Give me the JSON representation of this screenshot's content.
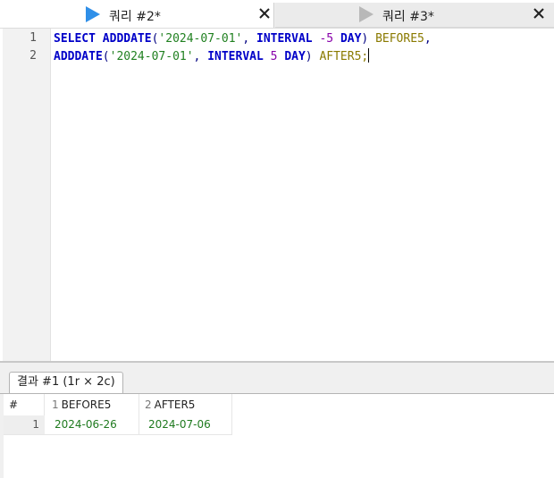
{
  "tabs": [
    {
      "label": "쿼리 #2*",
      "active": true,
      "icon": "play-icon",
      "icon_color": "#2f8fe8"
    },
    {
      "label": "쿼리 #3*",
      "active": false,
      "icon": "play-icon",
      "icon_color": "#b8b8b8"
    }
  ],
  "editor": {
    "line_numbers": [
      "1",
      "2"
    ],
    "lines": [
      [
        {
          "t": "SELECT",
          "k": "kw"
        },
        {
          "t": " ",
          "k": ""
        },
        {
          "t": "ADDDATE",
          "k": "fn"
        },
        {
          "t": "(",
          "k": "punc"
        },
        {
          "t": "'2024-07-01'",
          "k": "str"
        },
        {
          "t": ", ",
          "k": "punc"
        },
        {
          "t": "INTERVAL",
          "k": "kw"
        },
        {
          "t": " ",
          "k": ""
        },
        {
          "t": "-5",
          "k": "num"
        },
        {
          "t": " ",
          "k": ""
        },
        {
          "t": "DAY",
          "k": "kw"
        },
        {
          "t": ") ",
          "k": "punc"
        },
        {
          "t": "BEFORE5",
          "k": "alias"
        },
        {
          "t": ",",
          "k": "punc"
        }
      ],
      [
        {
          "t": "ADDDATE",
          "k": "fn"
        },
        {
          "t": "(",
          "k": "punc"
        },
        {
          "t": "'2024-07-01'",
          "k": "str"
        },
        {
          "t": ", ",
          "k": "punc"
        },
        {
          "t": "INTERVAL",
          "k": "kw"
        },
        {
          "t": " ",
          "k": ""
        },
        {
          "t": "5",
          "k": "num"
        },
        {
          "t": " ",
          "k": ""
        },
        {
          "t": "DAY",
          "k": "kw"
        },
        {
          "t": ") ",
          "k": "punc"
        },
        {
          "t": "AFTER5",
          "k": "alias"
        },
        {
          "t": ";",
          "k": "alias"
        }
      ]
    ]
  },
  "results": {
    "tab_label": "결과 #1 (1r × 2c)",
    "columns": [
      {
        "index": "",
        "name": "#"
      },
      {
        "index": "1",
        "name": "BEFORE5"
      },
      {
        "index": "2",
        "name": "AFTER5"
      }
    ],
    "rows": [
      {
        "row_number": "1",
        "values": [
          "2024-06-26",
          "2024-07-06"
        ]
      }
    ]
  }
}
